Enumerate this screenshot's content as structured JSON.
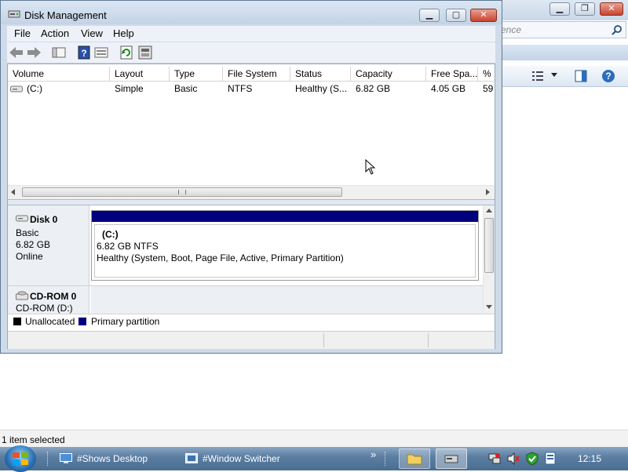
{
  "background_window": {
    "search_placeholder": "ence",
    "status_text": "1 item selected"
  },
  "window": {
    "title": "Disk Management",
    "menu": [
      "File",
      "Action",
      "View",
      "Help"
    ]
  },
  "volume_list": {
    "columns": [
      "Volume",
      "Layout",
      "Type",
      "File System",
      "Status",
      "Capacity",
      "Free Spa...",
      "% F"
    ],
    "rows": [
      [
        "(C:)",
        "Simple",
        "Basic",
        "NTFS",
        "Healthy (S...",
        "6.82 GB",
        "4.05 GB",
        "59"
      ]
    ]
  },
  "disks": [
    {
      "name": "Disk 0",
      "type": "Basic",
      "size": "6.82 GB",
      "state": "Online",
      "partition": {
        "label": "(C:)",
        "size_fs": "6.82 GB NTFS",
        "status": "Healthy (System, Boot, Page File, Active, Primary Partition)"
      }
    },
    {
      "name": "CD-ROM 0",
      "type": "CD-ROM (D:)"
    }
  ],
  "legend": {
    "unallocated": "Unallocated",
    "primary": "Primary partition"
  },
  "colors": {
    "unallocated": "#000000",
    "primary": "#00007f"
  },
  "taskbar": {
    "items": [
      "#Shows Desktop",
      "#Window Switcher"
    ],
    "overflow": "»",
    "time": "12:15"
  }
}
